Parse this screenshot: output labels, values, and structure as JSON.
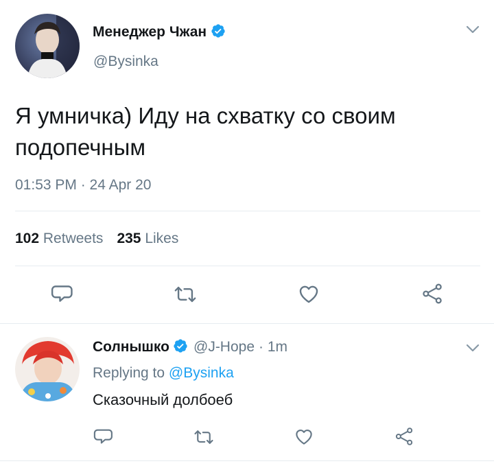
{
  "main_tweet": {
    "display_name": "Менеджер Чжан",
    "handle": "@Bysinka",
    "text": "Я умничка) Иду на схватку со своим подопечным",
    "timestamp": "01:53 PM · 24 Apr 20",
    "retweets_count": "102",
    "retweets_label": "Retweets",
    "likes_count": "235",
    "likes_label": "Likes"
  },
  "reply": {
    "display_name": "Солнышко",
    "handle": "@J-Hope",
    "time": "· 1m",
    "replying_prefix": "Replying to",
    "replying_handle": "@Bysinka",
    "text": "Сказочный долбоеб"
  },
  "icons": {
    "reply": "reply-icon",
    "retweet": "retweet-icon",
    "like": "heart-icon",
    "share": "share-icon",
    "verified": "verified-badge-icon",
    "chevron": "chevron-down-icon"
  },
  "colors": {
    "accent": "#1da1f2",
    "muted_text": "#657786",
    "icon_gray": "#657786",
    "divider": "#e6ecf0"
  }
}
